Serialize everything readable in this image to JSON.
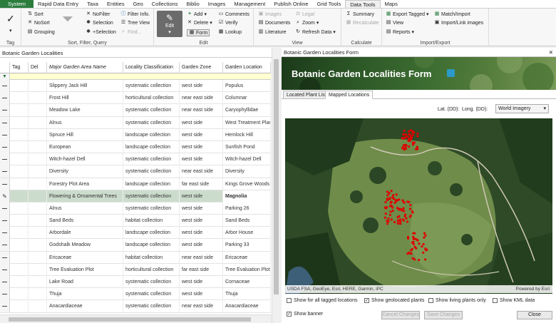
{
  "menu": [
    "System",
    "Rapid Data Entry",
    "Taxa",
    "Entities",
    "Geo",
    "Collections",
    "Biblio",
    "Images",
    "Management",
    "Publish Online",
    "Grid Tools",
    "Data Tools",
    "Maps"
  ],
  "ribbon": {
    "tag_label": "Tag",
    "sort": "Sort",
    "nosort": "NoSort",
    "grouping": "Grouping",
    "nofilter": "NoFilter",
    "selection": "Selection",
    "plus_selection": "+Selection",
    "filter_info": "Filter Info.",
    "tree_view": "Tree View",
    "find": "Find...",
    "sfq_label": "Sort, Filter, Query",
    "edit_big": "Edit",
    "add": "Add",
    "delete": "Delete",
    "form": "Form",
    "comments": "Comments",
    "verify": "Verify",
    "lookup": "Lookup",
    "edit_label": "Edit",
    "images": "Images",
    "legal": "Legal",
    "documents": "Documents",
    "zoom": "Zoom",
    "literature": "Literature",
    "refresh_data": "Refresh Data",
    "view_label": "View",
    "summary": "Summary",
    "recalculate": "Recalculate",
    "calculate_label": "Calculate",
    "export_tagged": "Export Tagged",
    "match_import": "Match/Import",
    "view": "View",
    "import_link_images": "Import/Link images",
    "reports": "Reports",
    "import_export_label": "Import/Export"
  },
  "grid": {
    "title": "Botanic Garden Localities",
    "columns": [
      "Tag",
      "Del",
      "Major Garden Area Name",
      "Locality Classification",
      "Garden Zone",
      "Garden Location"
    ],
    "rows": [
      [
        "Slippery Jack Hill",
        "systematic collection",
        "west side",
        "Populus"
      ],
      [
        "Frost Hill",
        "horticultural collection",
        "near east side",
        "Columnar"
      ],
      [
        "Meadow Lake",
        "systematic collection",
        "near east side",
        "Caryophyllidae"
      ],
      [
        "Alnus",
        "systematic collection",
        "west side",
        "West Treatment Plant"
      ],
      [
        "Spruce Hill",
        "landscape collection",
        "west side",
        "Hemlock Hill"
      ],
      [
        "European",
        "landscape collection",
        "west side",
        "Sunfish Pond"
      ],
      [
        "Witch-hazel Dell",
        "systematic collection",
        "west side",
        "Witch-hazel Dell"
      ],
      [
        "Diversity",
        "systematic collection",
        "near east side",
        "Diversity"
      ],
      [
        "Forestry Plot Area",
        "landscape collection",
        "far east side",
        "Kings Grove Woods"
      ],
      [
        "Flowering & Ornamental Trees",
        "systematic collection",
        "west side",
        "Magnolia"
      ],
      [
        "Alnus",
        "systematic collection",
        "west side",
        "Parking 26"
      ],
      [
        "Sand Beds",
        "habitat collection",
        "west side",
        "Sand Beds"
      ],
      [
        "Arbordale",
        "landscape collection",
        "west side",
        "Arbor House"
      ],
      [
        "Godshalk Meadow",
        "landscape collection",
        "west side",
        "Parking 33"
      ],
      [
        "Ericaceae",
        "habitat collection",
        "near east side",
        "Ericaceae"
      ],
      [
        "Tree Evaluation Plot",
        "horticultural collection",
        "far east side",
        "Tree Evaluation Plot"
      ],
      [
        "Lake Road",
        "systematic collection",
        "west side",
        "Cornaceae"
      ],
      [
        "Thuja",
        "systematic collection",
        "west side",
        "Thuja"
      ],
      [
        "Anacardiaceae",
        "systematic collection",
        "near east side",
        "Anacardiaceae"
      ]
    ]
  },
  "form": {
    "window_title": "Botanic Garden Localities Form",
    "banner_title": "Botanic Garden Localities Form",
    "tabs": [
      "Located Plant List",
      "Mapped Locations"
    ],
    "lat_label": "Lat. (DD):",
    "long_label": "Long. (DD):",
    "basemap": "World Imagery",
    "attribution": "USDA FSA, GeoEye, Esri, HERE, Garmin, iPC",
    "powered_by": "Powered by Esri",
    "checks": [
      "Show for all tagged locations",
      "Show geolocated plants",
      "Show living plants only",
      "Show KML data"
    ],
    "show_banner": "Show banner",
    "cancel_changes": "Cancel Changes",
    "save_changes": "Save Changes",
    "close": "Close"
  },
  "colors": {
    "system_tab": "#2b7d3e",
    "selected_row": "#ccdccc",
    "plant_marker": "#e00000",
    "map_field": "#6f8c4a"
  }
}
